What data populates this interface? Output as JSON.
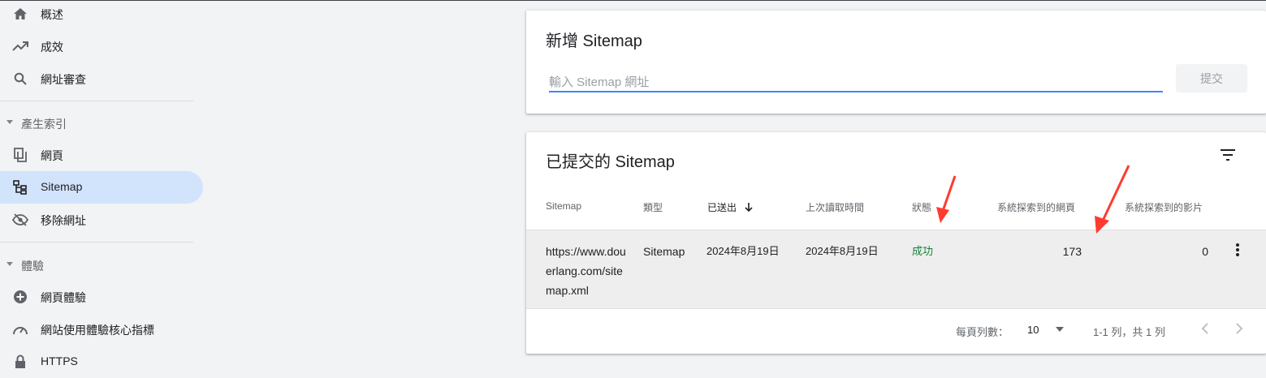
{
  "sidebar": {
    "items": [
      {
        "label": "概述",
        "icon": "home-icon"
      },
      {
        "label": "成效",
        "icon": "trending-up-icon"
      },
      {
        "label": "網址審查",
        "icon": "search-icon"
      }
    ],
    "sections": [
      {
        "label": "產生索引"
      },
      {
        "label": "體驗"
      }
    ],
    "index_items": [
      {
        "label": "網頁",
        "icon": "pages-icon"
      },
      {
        "label": "Sitemap",
        "icon": "sitemap-icon",
        "active": true
      },
      {
        "label": "移除網址",
        "icon": "visibility-off-icon"
      }
    ],
    "experience_items": [
      {
        "label": "網頁體驗",
        "icon": "add-circle-icon"
      },
      {
        "label": "網站使用體驗核心指標",
        "icon": "speed-icon"
      },
      {
        "label": "HTTPS",
        "icon": "lock-icon"
      }
    ]
  },
  "add_sitemap": {
    "title": "新增 Sitemap",
    "input_placeholder": "輸入 Sitemap 網址",
    "input_value": "",
    "submit_label": "提交"
  },
  "submitted": {
    "title": "已提交的 Sitemap",
    "columns": [
      "Sitemap",
      "類型",
      "已送出",
      "上次讀取時間",
      "狀態",
      "系統探索到的網頁",
      "系統探索到的影片"
    ],
    "rows": [
      {
        "sitemap": "https://www.douerlang.com/sitemap.xml",
        "type": "Sitemap",
        "submitted": "2024年8月19日",
        "last_read": "2024年8月19日",
        "status": "成功",
        "pages": "173",
        "videos": "0"
      }
    ],
    "rows_per_page_label": "每頁列數：",
    "rows_per_page_value": "10",
    "range_label": "1-1 列，共 1 列"
  },
  "colors": {
    "accent": "#4285f4",
    "active_nav": "#d2e3fc",
    "success": "#188038",
    "annotation": "#ff3b30"
  }
}
